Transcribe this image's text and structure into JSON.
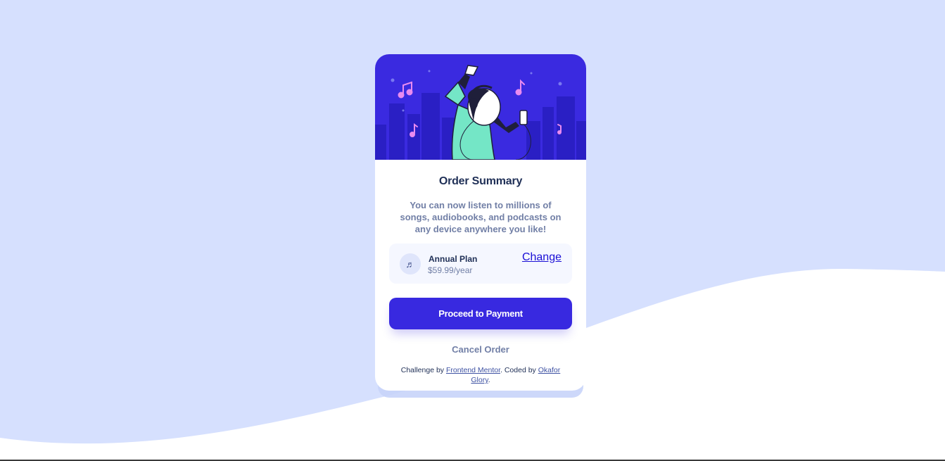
{
  "card": {
    "title": "Order Summary",
    "description": "You can now listen to millions of songs, audiobooks, and podcasts on any device anywhere you like!",
    "plan": {
      "icon": "music-note-icon",
      "name": "Annual Plan",
      "price": "$59.99/year",
      "change_label": "Change"
    },
    "proceed_label": "Proceed to Payment",
    "cancel_label": "Cancel Order"
  },
  "attribution": {
    "prefix": "Challenge by",
    "link1": "Frontend Mentor",
    "middle": ". Coded by",
    "link2": "Okafor Glory",
    "suffix": "."
  },
  "colors": {
    "background": "#d6e0fe",
    "primary": "#3829e0",
    "hero": "#3a2ae0",
    "text_dark": "#1f2f56",
    "text_muted": "#717fa6"
  }
}
